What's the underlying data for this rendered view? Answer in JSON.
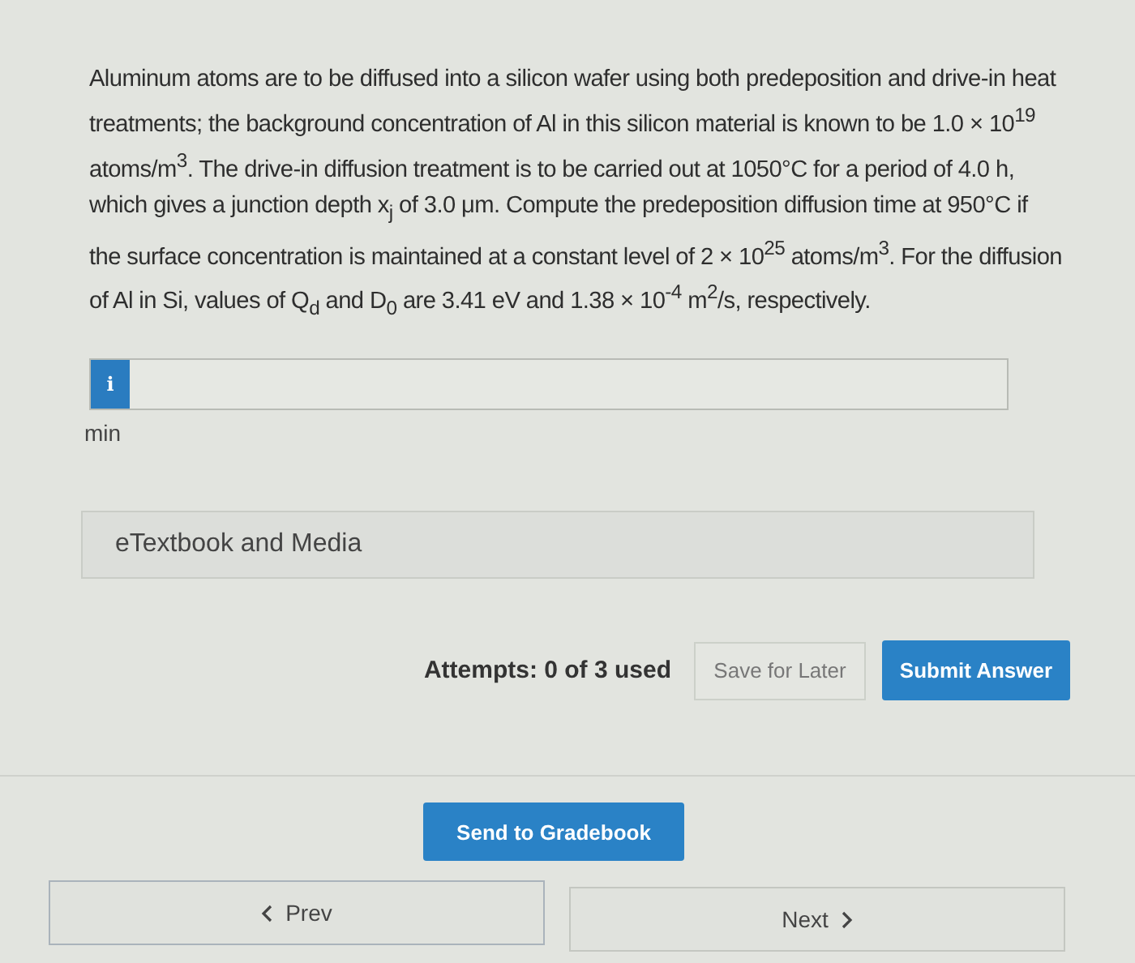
{
  "question": "Aluminum atoms are to be diffused into a silicon wafer using both predeposition and drive-in heat treatments; the background concentration of Al in this silicon material is known to be 1.0 × 10$^{19}$ atoms/m$^{3}$. The drive-in diffusion treatment is to be carried out at 1050°C for a period of 4.0 h, which gives a junction depth x$_{j}$ of 3.0 μm. Compute the predeposition diffusion time at 950°C if the surface concentration is maintained at a constant level of 2 × 10$^{25}$ atoms/m$^{3}$. For the diffusion of Al in Si, values of Q$_{d}$ and D$_{0}$ are 3.41 eV and 1.38 × 10$^{-4}$ m$^{2}$/s, respectively.",
  "answer": {
    "info_glyph": "i",
    "unit": "min"
  },
  "resources": {
    "label": "eTextbook and Media"
  },
  "attempts": "Attempts: 0 of 3 used",
  "save_button": "Save for Later",
  "submit_button": "Submit Answer",
  "gradebook_button": "Send to Gradebook",
  "nav": [
    {
      "kind": "prev",
      "label": "Prev"
    },
    {
      "kind": "next",
      "label": "Next"
    }
  ]
}
